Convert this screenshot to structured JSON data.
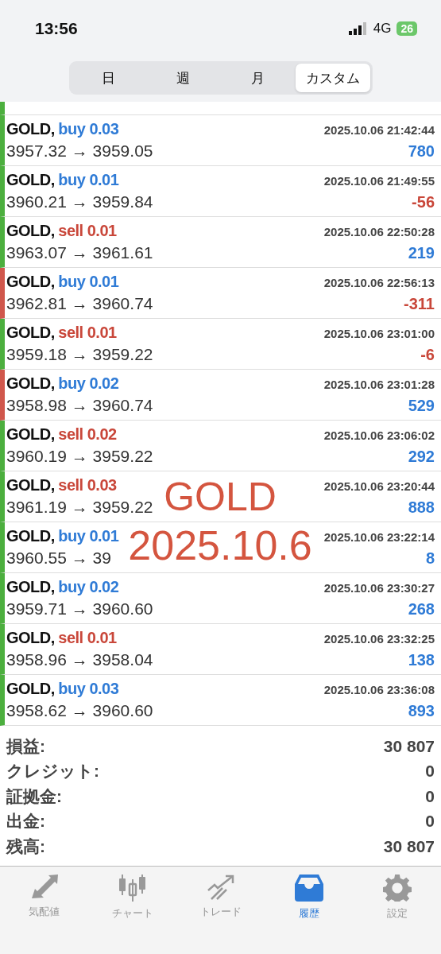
{
  "status_bar": {
    "time": "13:56",
    "network": "4G",
    "battery": "26"
  },
  "period_tabs": [
    {
      "label": "日",
      "selected": false
    },
    {
      "label": "週",
      "selected": false
    },
    {
      "label": "月",
      "selected": false
    },
    {
      "label": "カスタム",
      "selected": true
    }
  ],
  "deals": [
    {
      "symbol": "GOLD,",
      "kind": "buy",
      "volume": "buy 0.03",
      "time": "2025.10.06 21:42:44",
      "prices": "3957.32 → 3959.05",
      "profit": "780",
      "negative": false,
      "color": "#4caf3e"
    },
    {
      "symbol": "GOLD,",
      "kind": "buy",
      "volume": "buy 0.01",
      "time": "2025.10.06 21:49:55",
      "prices": "3960.21 → 3959.84",
      "profit": "-56",
      "negative": true,
      "color": "#4caf3e"
    },
    {
      "symbol": "GOLD,",
      "kind": "sell",
      "volume": "sell 0.01",
      "time": "2025.10.06 22:50:28",
      "prices": "3963.07 → 3961.61",
      "profit": "219",
      "negative": false,
      "color": "#4caf3e"
    },
    {
      "symbol": "GOLD,",
      "kind": "buy",
      "volume": "buy 0.01",
      "time": "2025.10.06 22:56:13",
      "prices": "3962.81 → 3960.74",
      "profit": "-311",
      "negative": true,
      "color": "#d0574c"
    },
    {
      "symbol": "GOLD,",
      "kind": "sell",
      "volume": "sell 0.01",
      "time": "2025.10.06 23:01:00",
      "prices": "3959.18 → 3959.22",
      "profit": "-6",
      "negative": true,
      "color": "#4caf3e"
    },
    {
      "symbol": "GOLD,",
      "kind": "buy",
      "volume": "buy 0.02",
      "time": "2025.10.06 23:01:28",
      "prices": "3958.98 → 3960.74",
      "profit": "529",
      "negative": false,
      "color": "#d0574c"
    },
    {
      "symbol": "GOLD,",
      "kind": "sell",
      "volume": "sell 0.02",
      "time": "2025.10.06 23:06:02",
      "prices": "3960.19 → 3959.22",
      "profit": "292",
      "negative": false,
      "color": "#4caf3e"
    },
    {
      "symbol": "GOLD,",
      "kind": "sell",
      "volume": "sell 0.03",
      "time": "2025.10.06 23:20:44",
      "prices": "3961.19 → 3959.22",
      "profit": "888",
      "negative": false,
      "color": "#4caf3e"
    },
    {
      "symbol": "GOLD,",
      "kind": "buy",
      "volume": "buy 0.01",
      "time": "2025.10.06 23:22:14",
      "prices": "3960.55 → 39",
      "profit": "8",
      "negative": false,
      "color": "#4caf3e"
    },
    {
      "symbol": "GOLD,",
      "kind": "buy",
      "volume": "buy 0.02",
      "time": "2025.10.06 23:30:27",
      "prices": "3959.71 → 3960.60",
      "profit": "268",
      "negative": false,
      "color": "#4caf3e"
    },
    {
      "symbol": "GOLD,",
      "kind": "sell",
      "volume": "sell 0.01",
      "time": "2025.10.06 23:32:25",
      "prices": "3958.96 → 3958.04",
      "profit": "138",
      "negative": false,
      "color": "#4caf3e"
    },
    {
      "symbol": "GOLD,",
      "kind": "buy",
      "volume": "buy 0.03",
      "time": "2025.10.06 23:36:08",
      "prices": "3958.62 → 3960.60",
      "profit": "893",
      "negative": false,
      "color": "#4caf3e"
    }
  ],
  "summary": [
    {
      "label": "損益:",
      "value": "30 807"
    },
    {
      "label": "クレジット:",
      "value": "0"
    },
    {
      "label": "証拠金:",
      "value": "0"
    },
    {
      "label": "出金:",
      "value": "0"
    },
    {
      "label": "残高:",
      "value": "30 807"
    }
  ],
  "annotation": [
    "GOLD",
    "2025.10.6"
  ],
  "tab_bar": [
    {
      "kind": "quotes",
      "label": "気配値",
      "selected": false
    },
    {
      "kind": "chart",
      "label": "チャート",
      "selected": false
    },
    {
      "kind": "trade",
      "label": "トレード",
      "selected": false
    },
    {
      "kind": "history",
      "label": "履歴",
      "selected": true
    },
    {
      "kind": "settings",
      "label": "設定",
      "selected": false
    }
  ]
}
